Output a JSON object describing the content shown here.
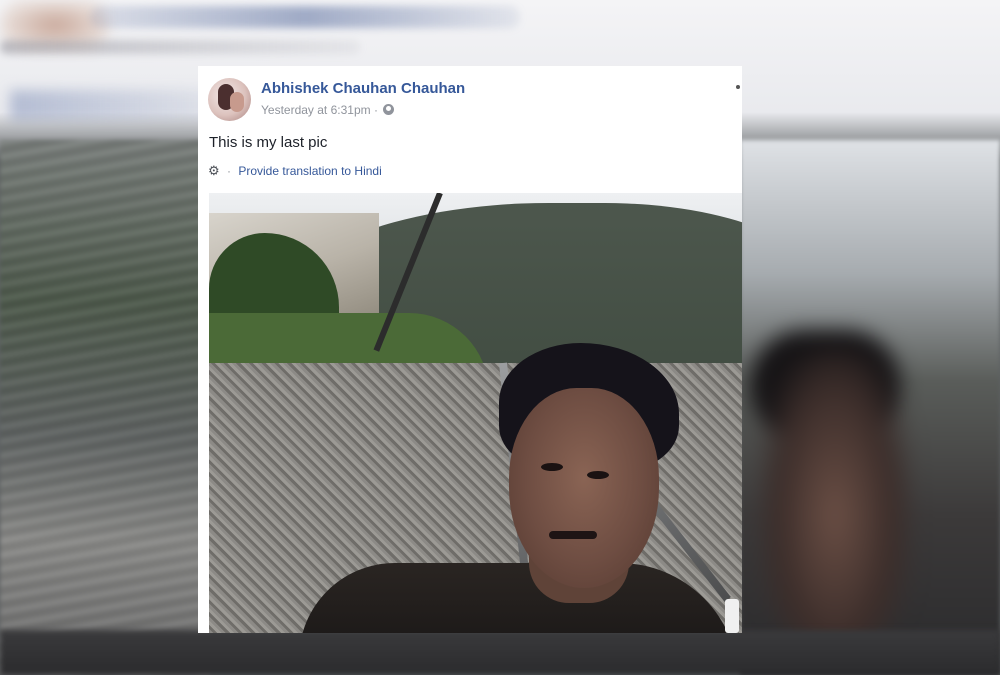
{
  "post": {
    "author": "Abhishek Chauhan Chauhan",
    "timestamp": "Yesterday at 6:31pm",
    "separator": "·",
    "audience_icon": "globe-icon",
    "text": "This is my last pic",
    "translate": {
      "icon": "gear-icon",
      "separator": "·",
      "label": "Provide translation to Hindi"
    },
    "menu_icon": "more-options-icon"
  },
  "colors": {
    "link": "#365899",
    "meta": "#90949c",
    "text": "#1d2129",
    "card_bg": "#ffffff"
  }
}
